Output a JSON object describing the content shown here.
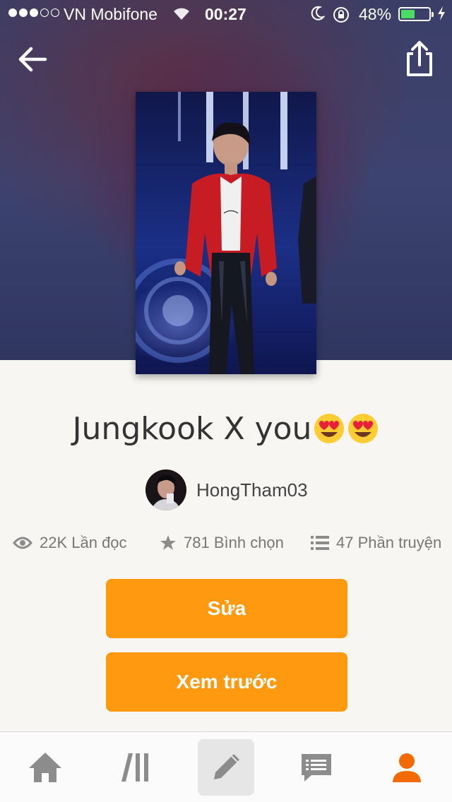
{
  "status_bar": {
    "carrier": "VN Mobifone",
    "time": "00:27",
    "battery_percent": "48%",
    "battery_level": 0.48,
    "signal_bars": 3
  },
  "story": {
    "title": "Jungkook X you",
    "author": "HongTham03"
  },
  "stats": {
    "reads": "22K Lần đọc",
    "votes": "781 Bình chọn",
    "parts": "47 Phần truyện"
  },
  "actions": {
    "edit_label": "Sửa",
    "preview_label": "Xem trước"
  },
  "tabbar": {
    "items": [
      "home-icon",
      "library-icon",
      "write-icon",
      "messages-icon",
      "profile-icon"
    ],
    "active": "write-icon"
  },
  "colors": {
    "accent": "#ff9a10",
    "active_tab_icon": "#f26a00",
    "tab_icon": "#8c8c8c"
  }
}
